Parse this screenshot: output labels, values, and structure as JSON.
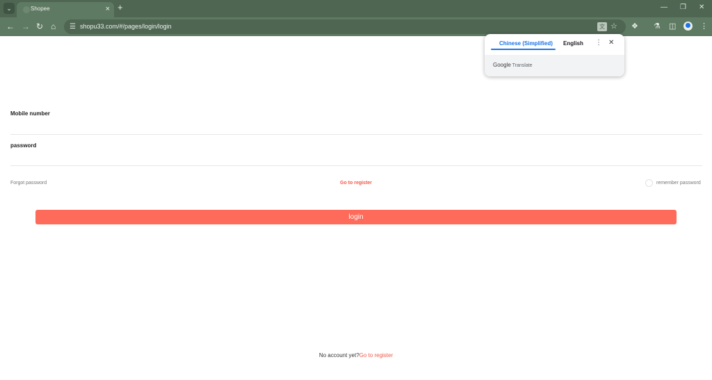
{
  "browser": {
    "tab_title": "Shopee",
    "new_tab_glyph": "+",
    "url": "shopu33.com/#/pages/login/login"
  },
  "translate_popup": {
    "source_language": "Chinese (Simplified)",
    "target_language": "English",
    "footer_brand": "Google",
    "footer_product": "Translate"
  },
  "form": {
    "mobile_label": "Mobile number",
    "password_label": "password",
    "forgot_password": "Forgot password",
    "go_register": "Go to register",
    "remember_password": "remember password",
    "login_button": "login"
  },
  "footer": {
    "prompt": "No account yet?",
    "register_link": "Go to register"
  },
  "colors": {
    "browser_frame": "#4e6652",
    "browser_toolbar": "#5f7a62",
    "accent_red": "#f0584a",
    "login_button": "#fe6b5a",
    "translate_blue": "#1a73e8"
  },
  "icons": [
    "tab-search-icon",
    "tab-close-icon",
    "new-tab-icon",
    "minimize-icon",
    "restore-icon",
    "window-close-icon",
    "back-icon",
    "forward-icon",
    "reload-icon",
    "home-icon",
    "site-settings-icon",
    "translate-icon",
    "bookmark-star-icon",
    "extensions-icon",
    "labs-icon",
    "side-panel-icon",
    "profile-icon",
    "menu-icon",
    "more-options-icon",
    "close-icon"
  ]
}
